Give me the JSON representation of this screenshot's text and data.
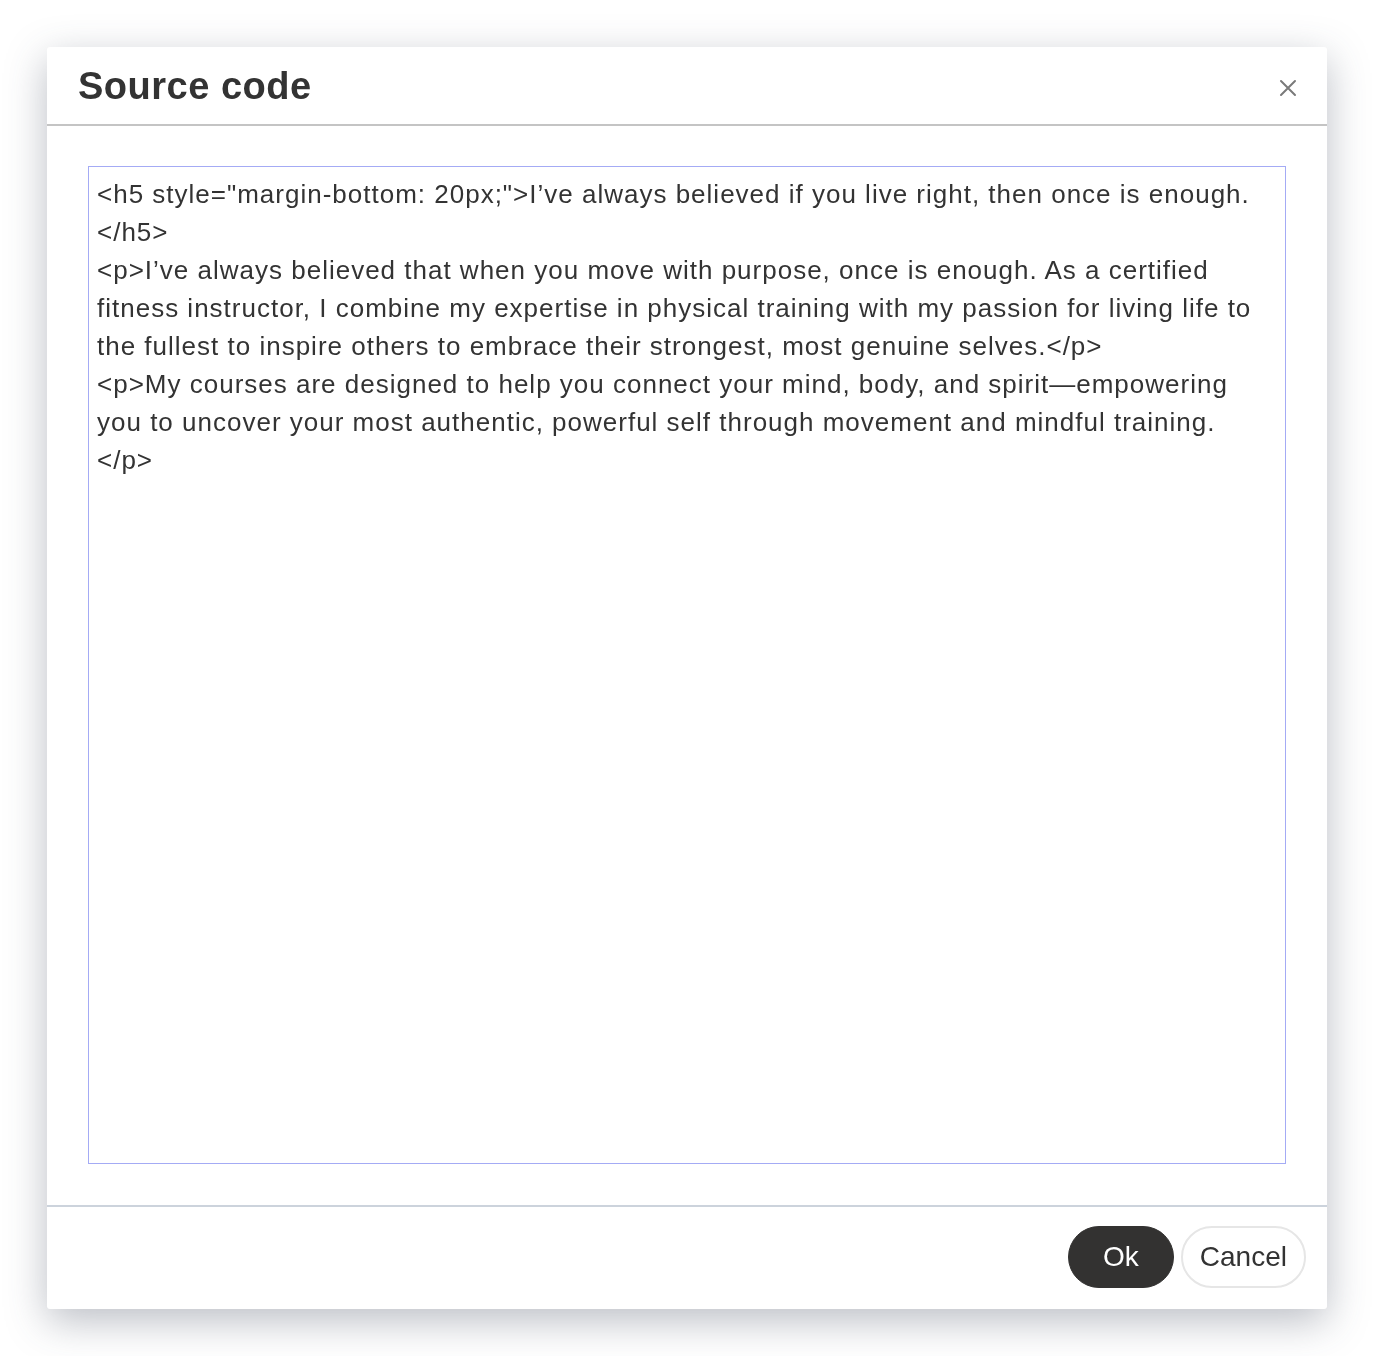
{
  "dialog": {
    "title": "Source code"
  },
  "editor": {
    "value": "<h5 style=\"margin-bottom: 20px;\">I’ve always believed if you live right, then once is enough.\n</h5>\n<p>I’ve always believed that when you move with purpose, once is enough. As a certified fitness instructor, I combine my expertise in physical training with my passion for living life to the fullest to inspire others to embrace their strongest, most genuine selves.</p>\n<p>My courses are designed to help you connect your mind, body, and spirit—empowering you to uncover your most authentic, powerful self through movement and mindful training.\n</p>"
  },
  "buttons": [
    {
      "label": "Ok",
      "kind": "primary"
    },
    {
      "label": "Cancel",
      "kind": "secondary"
    }
  ]
}
